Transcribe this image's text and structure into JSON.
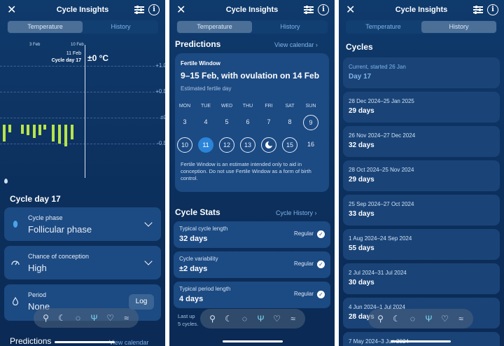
{
  "app_title": "Cycle Insights",
  "tabs": {
    "temperature": "Temperature",
    "history": "History"
  },
  "chart": {
    "date_label_1": "3 Feb",
    "date_label_2": "10 Feb",
    "cursor_date": "11 Feb",
    "cursor_cycle_day": "Cycle day 17",
    "cursor_value": "±0 °C",
    "y_labels": [
      "+1.0",
      "+0.5",
      "±0",
      "-0.5"
    ],
    "bars": [
      -0.33,
      -0.15,
      -0.18,
      -0.2,
      -0.25,
      -0.2,
      -0.1,
      -0.33,
      -0.36,
      -0.42,
      -0.28
    ],
    "accent": "#b7e44a"
  },
  "screen1": {
    "cycle_day_heading": "Cycle day 17",
    "phase_label": "Cycle phase",
    "phase_value": "Follicular phase",
    "conception_label": "Chance of conception",
    "conception_value": "High",
    "period_label": "Period",
    "period_value": "None",
    "log_button": "Log",
    "predictions_peek": "Predictions",
    "view_calendar_peek": "View calendar"
  },
  "screen2": {
    "predictions_heading": "Predictions",
    "view_calendar": "View calendar",
    "fertile_title": "Fertile Window",
    "fertile_range": "9–15 Feb, with ovulation on 14 Feb",
    "fertile_sub": "Estimated fertile day",
    "dow": [
      "MON",
      "TUE",
      "WED",
      "THU",
      "FRI",
      "SAT",
      "SUN"
    ],
    "week1": [
      "3",
      "4",
      "5",
      "6",
      "7",
      "8",
      "9"
    ],
    "week2": [
      "10",
      "11",
      "12",
      "13",
      "",
      "15",
      "16"
    ],
    "note": "Fertile Window is an estimate intended only to aid in conception. Do not use Fertile Window as a form of birth control.",
    "stats_heading": "Cycle Stats",
    "cycle_history_link": "Cycle History",
    "stats": [
      {
        "label": "Typical cycle length",
        "value": "32 days",
        "status": "Regular"
      },
      {
        "label": "Cycle variability",
        "value": "±2 days",
        "status": "Regular"
      },
      {
        "label": "Typical period length",
        "value": "4 days",
        "status": "Regular"
      }
    ],
    "last_updated_1": "Last up",
    "last_updated_2": "5 cycles."
  },
  "screen3": {
    "cycles_heading": "Cycles",
    "current": {
      "dates": "Current, started 26 Jan",
      "days": "Day 17"
    },
    "cycles": [
      {
        "dates": "28 Dec 2024–25 Jan 2025",
        "days": "29 days"
      },
      {
        "dates": "26 Nov 2024–27 Dec 2024",
        "days": "32 days"
      },
      {
        "dates": "28 Oct 2024–25 Nov 2024",
        "days": "29 days"
      },
      {
        "dates": "25 Sep 2024–27 Oct 2024",
        "days": "33 days"
      },
      {
        "dates": "1 Aug 2024–24 Sep 2024",
        "days": "55 days"
      },
      {
        "dates": "2 Jul 2024–31 Jul 2024",
        "days": "30 days"
      },
      {
        "dates": "4 Jun 2024–1 Jul 2024",
        "days": "28 days"
      },
      {
        "dates": "7 May 2024–3 Jun 2024",
        "days": ""
      }
    ]
  },
  "nav_icons": [
    "cycle-icon",
    "moon-icon",
    "drop-icon",
    "tree-icon",
    "heart-icon",
    "wave-icon"
  ],
  "nav_glyphs": [
    "⚲",
    "☾",
    "◌",
    "Ψ",
    "♡",
    "≈"
  ]
}
